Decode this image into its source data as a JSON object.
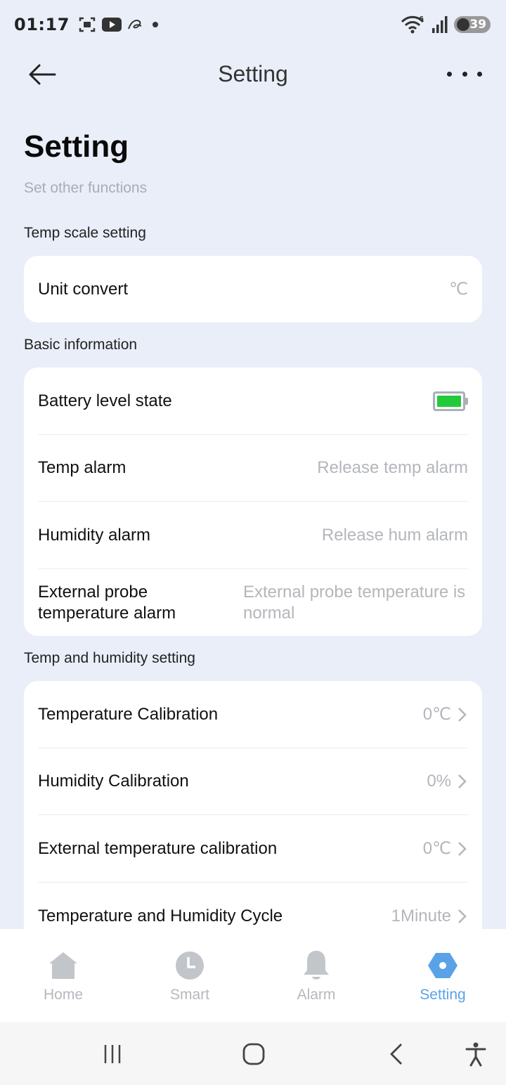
{
  "status_bar": {
    "time": "01:17",
    "battery": "39"
  },
  "app_bar": {
    "title": "Setting"
  },
  "header": {
    "title": "Setting",
    "subtitle": "Set other functions"
  },
  "sections": [
    {
      "label": "Temp scale setting",
      "rows": [
        {
          "label": "Unit convert",
          "value": "℃"
        }
      ]
    },
    {
      "label": "Basic information",
      "rows": [
        {
          "label": "Battery level state",
          "value": "",
          "battery_level": 1.0
        },
        {
          "label": "Temp alarm",
          "value": "Release temp alarm"
        },
        {
          "label": "Humidity alarm",
          "value": "Release hum alarm"
        },
        {
          "label": "External probe temperature alarm",
          "value": "External probe temperature is normal"
        }
      ]
    },
    {
      "label": "Temp and humidity setting",
      "rows": [
        {
          "label": "Temperature Calibration",
          "value": "0℃"
        },
        {
          "label": "Humidity Calibration",
          "value": "0%"
        },
        {
          "label": "External temperature calibration",
          "value": "0℃"
        },
        {
          "label": "Temperature and Humidity Cycle",
          "value": "1Minute"
        }
      ]
    }
  ],
  "tabs": [
    {
      "label": "Home",
      "icon": "home-icon",
      "active": false
    },
    {
      "label": "Smart",
      "icon": "clock-icon",
      "active": false
    },
    {
      "label": "Alarm",
      "icon": "bell-icon",
      "active": false
    },
    {
      "label": "Setting",
      "icon": "hexagon-gear-icon",
      "active": true
    }
  ],
  "colors": {
    "background": "#e9eef9",
    "accent": "#5aa2e8",
    "battery_fill": "#22c93a",
    "muted_text": "#b3b6bb"
  }
}
